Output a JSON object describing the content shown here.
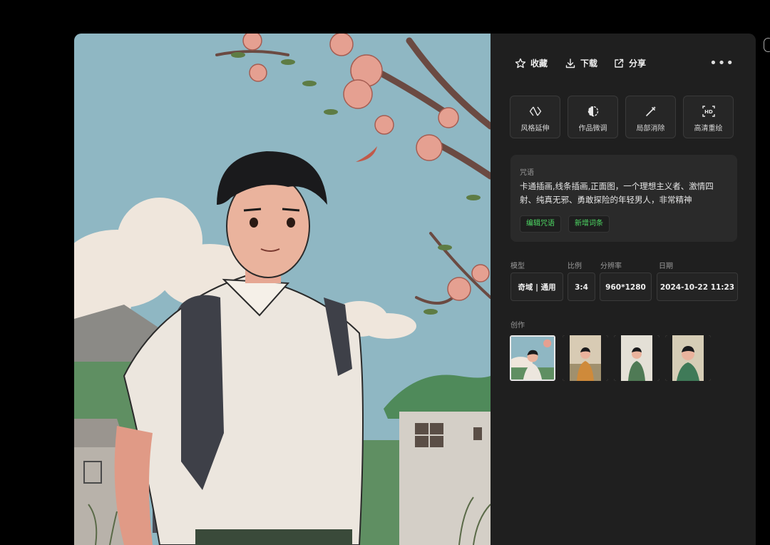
{
  "actions": {
    "favorite": {
      "label": "收藏",
      "icon": "star-icon"
    },
    "download": {
      "label": "下载",
      "icon": "download-icon"
    },
    "share": {
      "label": "分享",
      "icon": "share-icon"
    },
    "more": {
      "label": "•••",
      "icon": "more-icon"
    }
  },
  "tools": [
    {
      "label": "风格延伸",
      "icon": "style-extend-icon"
    },
    {
      "label": "作品微调",
      "icon": "fine-tune-icon"
    },
    {
      "label": "局部消除",
      "icon": "magic-eraser-icon"
    },
    {
      "label": "高清重绘",
      "icon": "hd-redraw-icon"
    }
  ],
  "prompt": {
    "label": "咒语",
    "text": "卡通插画,线条插画,正面图，一个理想主义者、激情四射、纯真无邪、勇敢探险的年轻男人，非常精神",
    "edit_label": "编辑咒语",
    "add_label": "新增词条"
  },
  "meta": {
    "model": {
      "label": "模型",
      "value": "奇域 | 通用"
    },
    "ratio": {
      "label": "比例",
      "value": "3:4"
    },
    "resolution": {
      "label": "分辨率",
      "value": "960*1280"
    },
    "date": {
      "label": "日期",
      "value": "2024-10-22 11:23"
    }
  },
  "creations": {
    "label": "创作",
    "items": [
      {
        "selected": true
      },
      {
        "selected": false
      },
      {
        "selected": false
      },
      {
        "selected": false
      }
    ]
  },
  "colors": {
    "accent_green": "#4ed964",
    "panel_bg": "#1f1f1f",
    "card_bg": "#2a2a2a",
    "sky": "#8fb7c3"
  }
}
